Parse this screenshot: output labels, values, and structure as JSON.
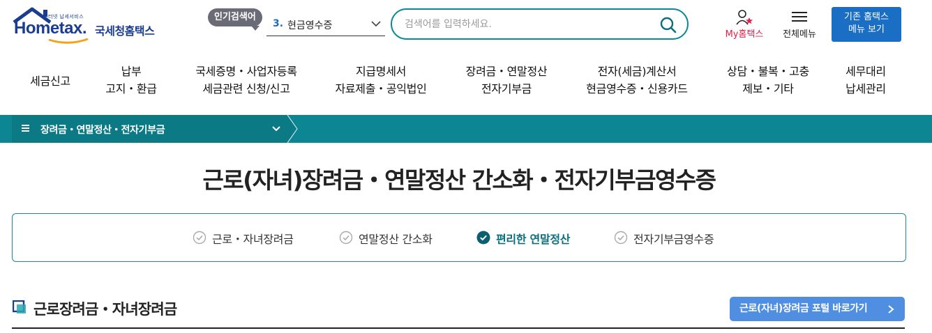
{
  "header": {
    "logo_small": "인터넷 납세서비스",
    "logo_word": "Hometax.",
    "logo_kr": "국세청홈택스",
    "popular_badge": "인기검색어",
    "popular_num": "3.",
    "popular_text": "현금영수증",
    "search_placeholder": "검색어를 입력하세요.",
    "my_hometax": "My홈택스",
    "all_menu": "전체메뉴",
    "legacy_button": "기존 홈택스\n메뉴 보기"
  },
  "nav": {
    "items": [
      "세금신고",
      "납부\n고지・환급",
      "국세증명・사업자등록\n세금관련 신청/신고",
      "지급명세서\n자료제출・공익법인",
      "장려금・연말정산\n전자기부금",
      "전자(세금)계산서\n현금영수증・신용카드",
      "상담・불복・고충\n제보・기타",
      "세무대리\n납세관리"
    ]
  },
  "subbar": {
    "label": "장려금・연말정산・전자기부금"
  },
  "page": {
    "title": "근로(자녀)장려금・연말정산 간소화・전자기부금영수증"
  },
  "tabs": {
    "items": [
      {
        "label": "근로・자녀장려금",
        "active": false
      },
      {
        "label": "연말정산 간소화",
        "active": false
      },
      {
        "label": "편리한 연말정산",
        "active": true
      },
      {
        "label": "전자기부금영수증",
        "active": false
      }
    ]
  },
  "section": {
    "title": "근로장려금・자녀장려금",
    "portal_button": "근로(자녀)장려금 포털 바로가기"
  },
  "colors": {
    "teal": "#0c8692",
    "brand_blue": "#1b3d8f",
    "button_blue": "#1a6fc4",
    "portal_blue": "#4f8ee0",
    "my_red": "#e0204d"
  }
}
